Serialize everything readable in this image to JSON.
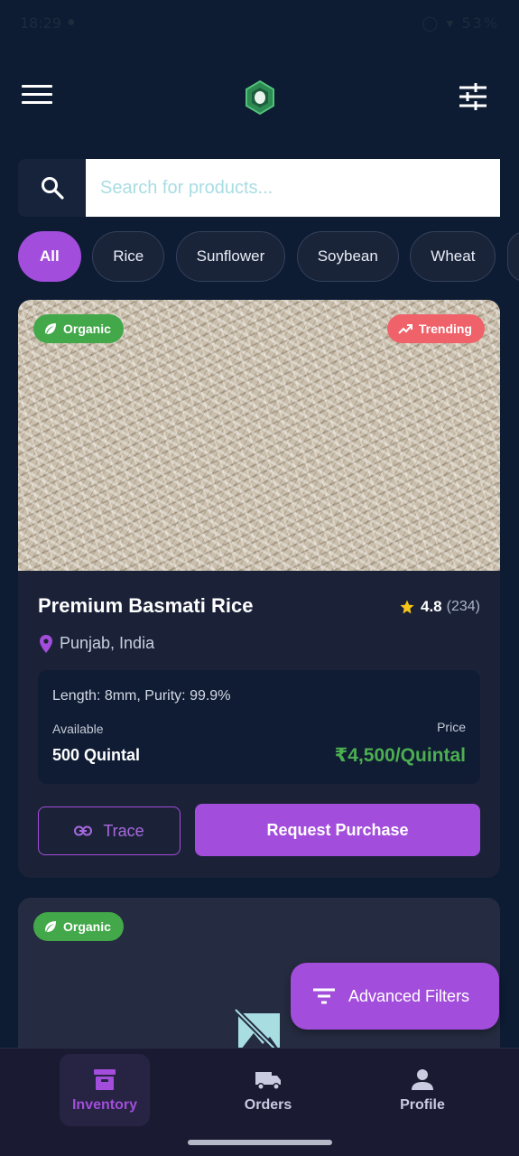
{
  "status_bar": {
    "time": "18:29",
    "battery": "53%"
  },
  "app_bar": {
    "menu_icon": "menu-icon",
    "logo": "app-logo-hexagon",
    "filter_icon": "tune-icon"
  },
  "search": {
    "placeholder": "Search for products...",
    "icon": "search-icon"
  },
  "categories": [
    "All",
    "Rice",
    "Sunflower",
    "Soybean",
    "Wheat"
  ],
  "selected_category": "All",
  "products": [
    {
      "badges": {
        "organic": "Organic",
        "trending": "Trending"
      },
      "name": "Premium Basmati Rice",
      "rating": "4.8",
      "reviews": "(234)",
      "location": "Punjab, India",
      "spec": "Length: 8mm, Purity: 99.9%",
      "available_label": "Available",
      "available": "500 Quintal",
      "price_label": "Price",
      "price": "₹4,500/Quintal",
      "trace_label": "Trace",
      "purchase_label": "Request Purchase"
    },
    {
      "badges": {
        "organic": "Organic"
      }
    }
  ],
  "fab": {
    "label": "Advanced Filters"
  },
  "bottom_nav": {
    "items": [
      {
        "label": "Inventory",
        "icon": "inventory-icon",
        "active": true
      },
      {
        "label": "Orders",
        "icon": "truck-icon",
        "active": false
      },
      {
        "label": "Profile",
        "icon": "person-icon",
        "active": false
      }
    ]
  },
  "colors": {
    "background": "#0d1b33",
    "accent": "#a24ddb",
    "organic": "#43a84a",
    "trending": "#f0626a",
    "price": "#4cae50"
  }
}
